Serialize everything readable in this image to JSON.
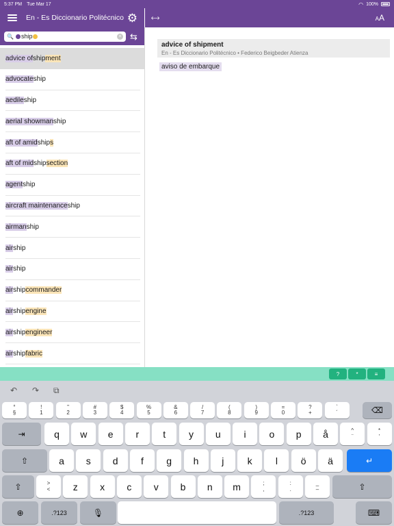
{
  "status_bar": {
    "time": "5:37 PM",
    "date": "Tue Mar 17",
    "battery": "100%"
  },
  "header": {
    "title": "En - Es Diccionario Politécnico"
  },
  "search": {
    "query": "ship"
  },
  "results": [
    {
      "segments": [
        {
          "t": "advice of ",
          "h": "p"
        },
        {
          "t": "ship",
          "h": ""
        },
        {
          "t": "ment",
          "h": "y"
        }
      ]
    },
    {
      "segments": [
        {
          "t": "advocate",
          "h": "p"
        },
        {
          "t": "ship",
          "h": ""
        }
      ]
    },
    {
      "segments": [
        {
          "t": "aedile",
          "h": "p"
        },
        {
          "t": "ship",
          "h": ""
        }
      ]
    },
    {
      "segments": [
        {
          "t": "aerial showman",
          "h": "p"
        },
        {
          "t": "ship",
          "h": ""
        }
      ]
    },
    {
      "segments": [
        {
          "t": "aft of amid",
          "h": "p"
        },
        {
          "t": "ship",
          "h": ""
        },
        {
          "t": "s",
          "h": "y"
        }
      ]
    },
    {
      "segments": [
        {
          "t": "aft of mid",
          "h": "p"
        },
        {
          "t": "ship",
          "h": ""
        },
        {
          "t": " section",
          "h": "y"
        }
      ]
    },
    {
      "segments": [
        {
          "t": "agent",
          "h": "p"
        },
        {
          "t": "ship",
          "h": ""
        }
      ]
    },
    {
      "segments": [
        {
          "t": "aircraft maintenance ",
          "h": "p"
        },
        {
          "t": "ship",
          "h": ""
        }
      ]
    },
    {
      "segments": [
        {
          "t": "airman",
          "h": "p"
        },
        {
          "t": "ship",
          "h": ""
        }
      ]
    },
    {
      "segments": [
        {
          "t": "air ",
          "h": "p"
        },
        {
          "t": "ship",
          "h": ""
        }
      ]
    },
    {
      "segments": [
        {
          "t": "air",
          "h": "p"
        },
        {
          "t": "ship",
          "h": ""
        }
      ]
    },
    {
      "segments": [
        {
          "t": "air",
          "h": "p"
        },
        {
          "t": "ship",
          "h": ""
        },
        {
          "t": " commander",
          "h": "y"
        }
      ]
    },
    {
      "segments": [
        {
          "t": "air",
          "h": "p"
        },
        {
          "t": "ship",
          "h": ""
        },
        {
          "t": " engine",
          "h": "y"
        }
      ]
    },
    {
      "segments": [
        {
          "t": "air",
          "h": "p"
        },
        {
          "t": "ship",
          "h": ""
        },
        {
          "t": " engineer",
          "h": "y"
        }
      ]
    },
    {
      "segments": [
        {
          "t": "air",
          "h": "p"
        },
        {
          "t": "ship",
          "h": ""
        },
        {
          "t": " fabric",
          "h": "y"
        }
      ]
    }
  ],
  "detail": {
    "title": "advice of shipment",
    "source": "En - Es Diccionario Politécnico • Federico Beigbeder Atienza",
    "translation": "aviso de embarque"
  },
  "accessory": {
    "buttons": [
      "?",
      "*",
      "≡"
    ]
  },
  "keyboard": {
    "row1": [
      [
        "°",
        "§"
      ],
      [
        "!",
        "1"
      ],
      [
        "\"",
        "2"
      ],
      [
        "#",
        "3"
      ],
      [
        "$",
        "4"
      ],
      [
        "%",
        "5"
      ],
      [
        "&",
        "6"
      ],
      [
        "/",
        "7"
      ],
      [
        "(",
        "8"
      ],
      [
        ")",
        "9"
      ],
      [
        "=",
        "0"
      ],
      [
        "?",
        "+"
      ],
      [
        "`",
        "´"
      ]
    ],
    "row2": [
      "q",
      "w",
      "e",
      "r",
      "t",
      "y",
      "u",
      "i",
      "o",
      "p",
      "å",
      [
        "^",
        "¨"
      ],
      [
        "*",
        "'"
      ]
    ],
    "row3": [
      "a",
      "s",
      "d",
      "f",
      "g",
      "h",
      "j",
      "k",
      "l",
      "ö",
      "ä"
    ],
    "row4": [
      [
        ">",
        "<"
      ],
      "z",
      "x",
      "c",
      "v",
      "b",
      "n",
      "m",
      [
        ";",
        ","
      ],
      [
        ":",
        "."
      ],
      [
        "_",
        "–"
      ]
    ],
    "numbers_label": ".?123"
  },
  "colors": {
    "header": "#6b4596",
    "highlight_purple": "#d8cde8",
    "highlight_yellow": "#fbe5b8",
    "accessory": "#86e0c4",
    "accessory_button": "#22b27f",
    "return_key": "#1a7cf5"
  }
}
